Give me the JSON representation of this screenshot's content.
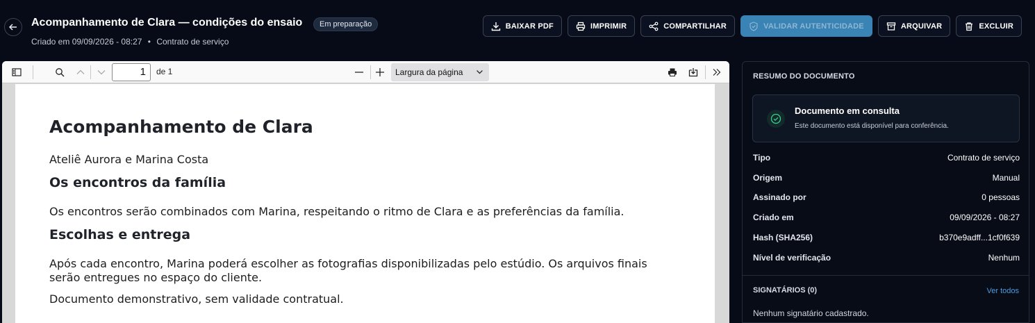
{
  "header": {
    "title": "Acompanhamento de Clara — condições do ensaio",
    "badge": "Em preparação",
    "created": "Criado em 09/09/2026 - 08:27",
    "separator": "•",
    "doc_type": "Contrato de serviço"
  },
  "actions": {
    "download": "BAIXAR PDF",
    "print": "IMPRIMIR",
    "share": "COMPARTILHAR",
    "validate": "VALIDAR AUTENTICIDADE",
    "archive": "ARQUIVAR",
    "delete": "EXCLUIR"
  },
  "viewer": {
    "page_number": "1",
    "page_total": "de 1",
    "zoom": "Largura da página"
  },
  "document": {
    "title": "Acompanhamento de Clara",
    "parties": "Ateliê Aurora e Marina Costa",
    "section1_title": "Os encontros da família",
    "section1_text": "Os encontros serão combinados com Marina, respeitando o ritmo de Clara e as preferências da família.",
    "section2_title": "Escolhas e entrega",
    "section2_text": "Após cada encontro, Marina poderá escolher as fotografias disponibilizadas pelo estúdio. Os arquivos finais serão entregues no espaço do cliente.",
    "disclaimer": "Documento demonstrativo, sem validade contratual."
  },
  "summary": {
    "title": "RESUMO DO DOCUMENTO",
    "status_title": "Documento em consulta",
    "status_desc": "Este documento está disponível para conferência.",
    "fields": [
      {
        "label": "Tipo",
        "value": "Contrato de serviço"
      },
      {
        "label": "Origem",
        "value": "Manual"
      },
      {
        "label": "Assinado por",
        "value": "0 pessoas"
      },
      {
        "label": "Criado em",
        "value": "09/09/2026 - 08:27"
      },
      {
        "label": "Hash (SHA256)",
        "value": "b370e9adff...1cf0f639"
      },
      {
        "label": "Nível de verificação",
        "value": "Nenhum"
      }
    ],
    "signers_title": "SIGNATÁRIOS (0)",
    "see_all": "Ver todos",
    "no_signers": "Nenhum signatário cadastrado."
  },
  "colors": {
    "background": "#060b17",
    "accent": "#3a83b5",
    "link": "#4e9be0",
    "success": "#3ecf8e"
  }
}
